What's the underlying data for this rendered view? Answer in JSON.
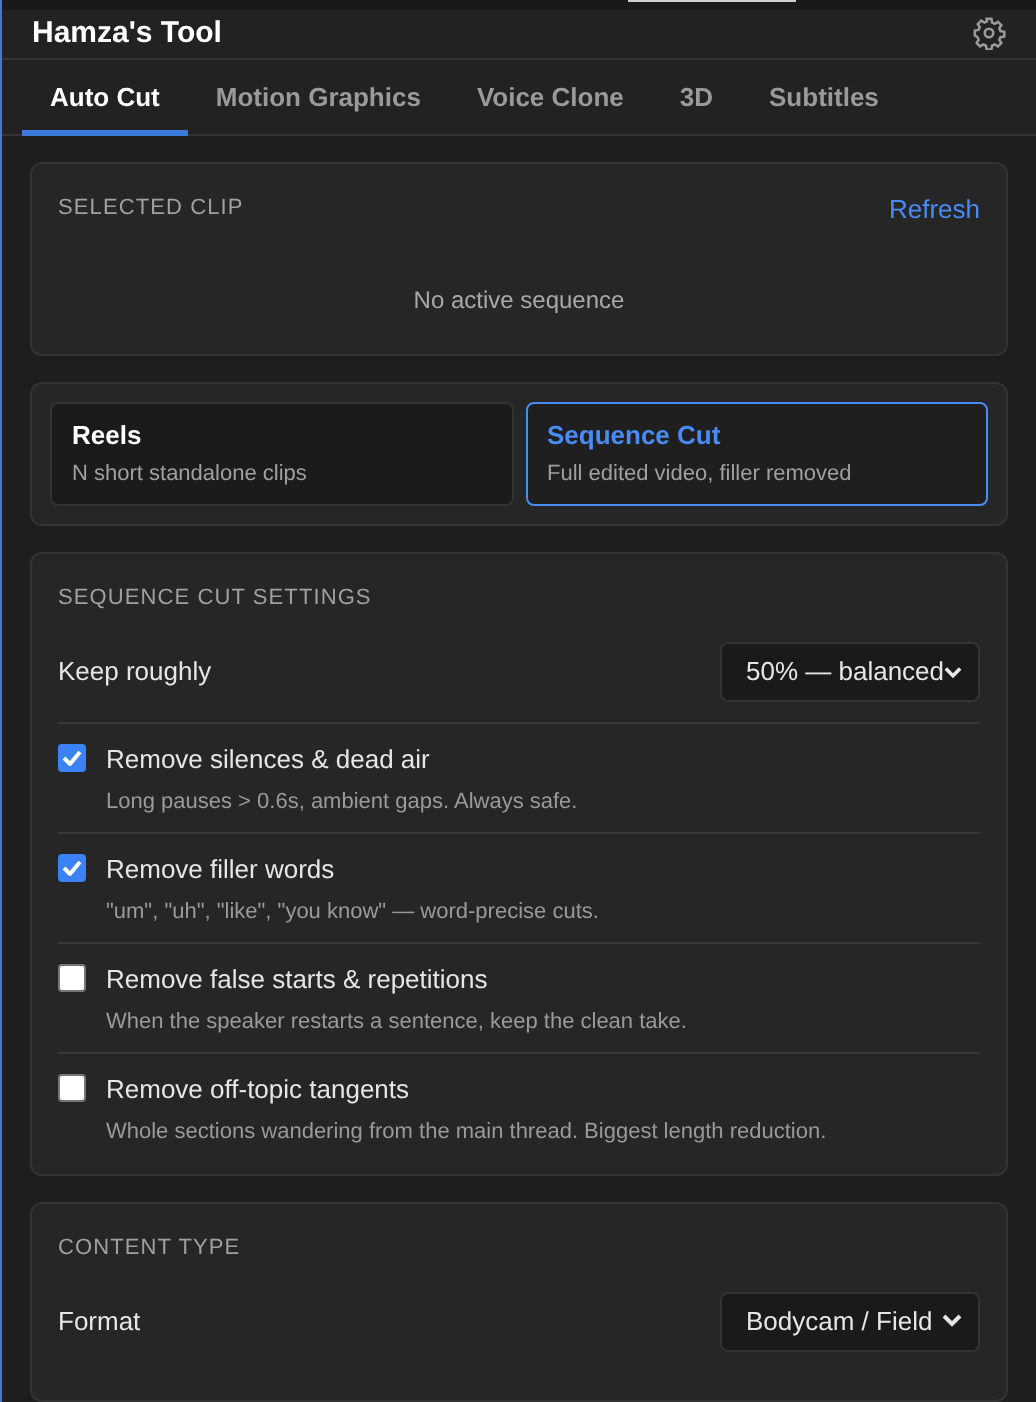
{
  "header": {
    "title": "Hamza's Tool"
  },
  "tabs": [
    {
      "label": "Auto Cut",
      "selected": true
    },
    {
      "label": "Motion Graphics",
      "selected": false
    },
    {
      "label": "Voice Clone",
      "selected": false
    },
    {
      "label": "3D",
      "selected": false
    },
    {
      "label": "Subtitles",
      "selected": false
    }
  ],
  "selected_clip": {
    "heading": "SELECTED CLIP",
    "action": "Refresh",
    "message": "No active sequence"
  },
  "modes": [
    {
      "title": "Reels",
      "description": "N short standalone clips",
      "selected": false
    },
    {
      "title": "Sequence Cut",
      "description": "Full edited video, filler removed",
      "selected": true
    }
  ],
  "sequence_cut_settings": {
    "heading": "SEQUENCE CUT SETTINGS",
    "keep": {
      "label": "Keep roughly",
      "value": "50% — balanced"
    },
    "options": [
      {
        "label": "Remove silences & dead air",
        "description": "Long pauses > 0.6s, ambient gaps. Always safe.",
        "checked": true
      },
      {
        "label": "Remove filler words",
        "description": "\"um\", \"uh\", \"like\", \"you know\" — word-precise cuts.",
        "checked": true
      },
      {
        "label": "Remove false starts & repetitions",
        "description": "When the speaker restarts a sentence, keep the clean take.",
        "checked": false
      },
      {
        "label": "Remove off-topic tangents",
        "description": "Whole sections wandering from the main thread. Biggest length reduction.",
        "checked": false
      }
    ]
  },
  "content_type": {
    "heading": "CONTENT TYPE",
    "format": {
      "label": "Format",
      "value": "Bodycam / Field"
    }
  }
}
